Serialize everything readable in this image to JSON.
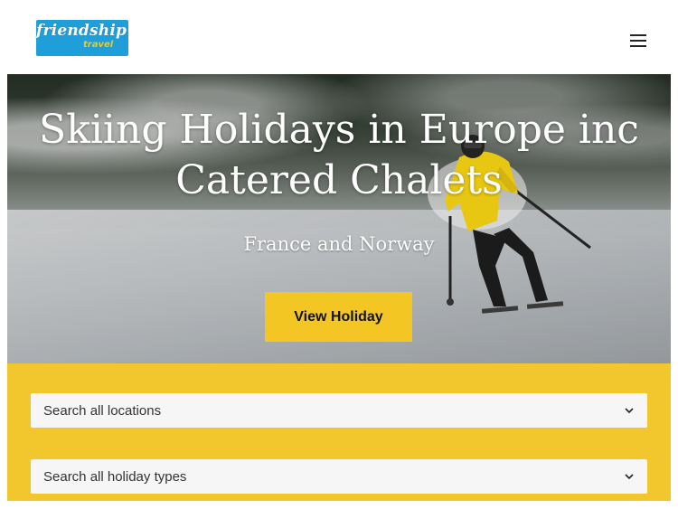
{
  "header": {
    "logo_main": "friendship",
    "logo_sub": "travel",
    "menu_icon": "hamburger-icon"
  },
  "hero": {
    "title_line1": "Skiing Holidays in Europe inc",
    "title_line2": "Catered Chalets",
    "subtitle": "France and Norway",
    "button_label": "View Holiday"
  },
  "search": {
    "locations_label": "Search all locations",
    "types_label": "Search all holiday types",
    "dropdown_icon": "chevron-down-icon"
  },
  "colors": {
    "accent": "#f3c623",
    "logo_blue": "#1e9fd9",
    "panel_yellow": "#f2c62d"
  }
}
